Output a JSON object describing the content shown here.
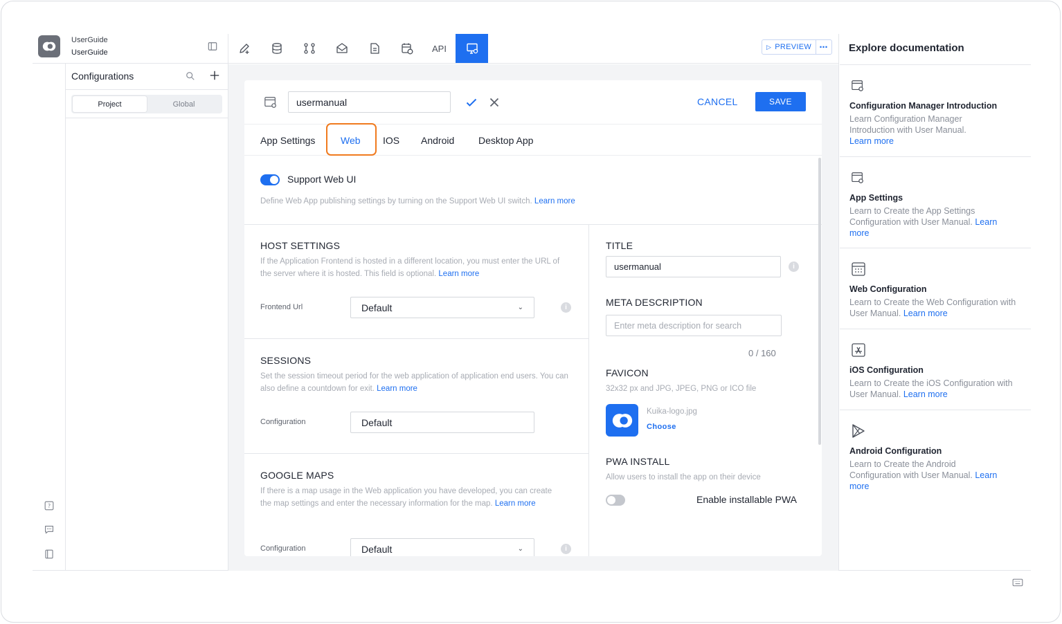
{
  "project": {
    "name": "UserGuide",
    "subname": "UserGuide"
  },
  "configurations": {
    "title": "Configurations",
    "segments": [
      "Project",
      "Global"
    ]
  },
  "toolbar": {
    "api_label": "API",
    "preview_label": "PREVIEW",
    "more_label": "⋯"
  },
  "editor": {
    "name_value": "usermanual",
    "cancel_label": "CANCEL",
    "save_label": "SAVE",
    "tabs": [
      "App Settings",
      "Web",
      "IOS",
      "Android",
      "Desktop App"
    ],
    "active_tab": "Web"
  },
  "web": {
    "support_label": "Support Web UI",
    "support_enabled": true,
    "support_desc": "Define Web App publishing settings by turning on the Support Web UI switch.",
    "learn_more": "Learn more",
    "host": {
      "title": "HOST SETTINGS",
      "desc": "If the Application Frontend is hosted in a different location, you must enter the URL of the server where it is hosted. This field is optional.",
      "field_label": "Frontend Url",
      "field_value": "Default"
    },
    "sessions": {
      "title": "SESSIONS",
      "desc": "Set the session timeout period for the web application of application end users. You can also define a countdown for exit.",
      "field_label": "Configuration",
      "field_value": "Default"
    },
    "maps": {
      "title": "GOOGLE MAPS",
      "desc": "If there is a map usage in the Web application you have developed, you can create the map settings and enter the necessary information for the map.",
      "field_label": "Configuration",
      "field_value": "Default"
    },
    "title_section": {
      "title": "TITLE",
      "value": "usermanual"
    },
    "meta": {
      "title": "META DESCRIPTION",
      "placeholder": "Enter meta description for search",
      "counter": "0 / 160"
    },
    "favicon": {
      "title": "FAVICON",
      "desc": "32x32 px and JPG, JPEG, PNG or ICO file",
      "file_name": "Kuika-logo.jpg",
      "choose_label": "Choose"
    },
    "pwa": {
      "title": "PWA INSTALL",
      "desc": "Allow users to install the app on their device",
      "toggle_label": "Enable installable PWA",
      "enabled": false
    }
  },
  "docs": {
    "title": "Explore documentation",
    "learn_more": "Learn more",
    "items": [
      {
        "title": "Configuration Manager Introduction",
        "desc": "Learn Configuration Manager Introduction with User Manual.",
        "icon": "config-window-icon"
      },
      {
        "title": "App Settings",
        "desc": "Learn to Create the App Settings Configuration with User Manual.",
        "icon": "config-window-icon"
      },
      {
        "title": "Web Configuration",
        "desc": "Learn to Create the Web Configuration with User Manual.",
        "icon": "web-grid-icon"
      },
      {
        "title": "iOS Configuration",
        "desc": "Learn to Create the iOS Configuration with User Manual.",
        "icon": "app-store-icon"
      },
      {
        "title": "Android Configuration",
        "desc": "Learn to Create the Android Configuration with User Manual.",
        "icon": "play-store-icon"
      }
    ]
  },
  "colors": {
    "accent": "#1e6ff0",
    "highlight": "#f07a1e",
    "toggle_off": "#c4c7cd"
  }
}
